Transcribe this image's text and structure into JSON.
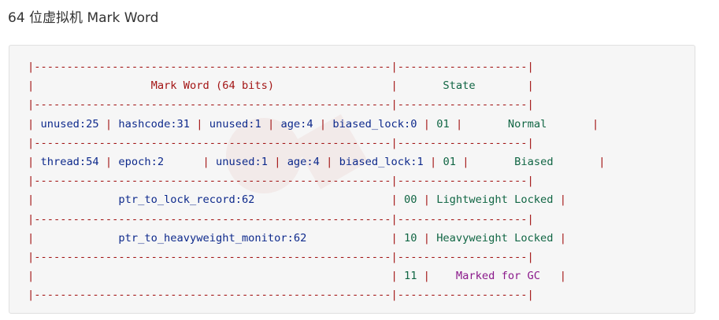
{
  "heading": "64 位虚拟机 Mark Word",
  "table": {
    "border": "|-------------------------------------------------------|--------------------|",
    "header": {
      "mark_word_title": "Mark Word (64 bits)",
      "state_title": "State"
    },
    "rows": [
      {
        "parts": [
          "unused:25",
          "hashcode:31",
          "unused:1",
          "age:4",
          "biased_lock:0",
          "01"
        ],
        "state": "Normal"
      },
      {
        "parts": [
          "thread:54",
          "epoch:2",
          "unused:1",
          "age:4",
          "biased_lock:1",
          "01"
        ],
        "state": "Biased"
      },
      {
        "parts": [
          "ptr_to_lock_record:62",
          "00"
        ],
        "state": "Lightweight Locked"
      },
      {
        "parts": [
          "ptr_to_heavyweight_monitor:62",
          "10"
        ],
        "state": "Heavyweight Locked"
      },
      {
        "parts": [
          "",
          "11"
        ],
        "state": "Marked for GC"
      }
    ]
  },
  "colors": {
    "border": "#a31515",
    "field_name": "#0e2a8c",
    "number": "#116644",
    "state": "#116644",
    "gc_state": "#8b1a8b"
  }
}
